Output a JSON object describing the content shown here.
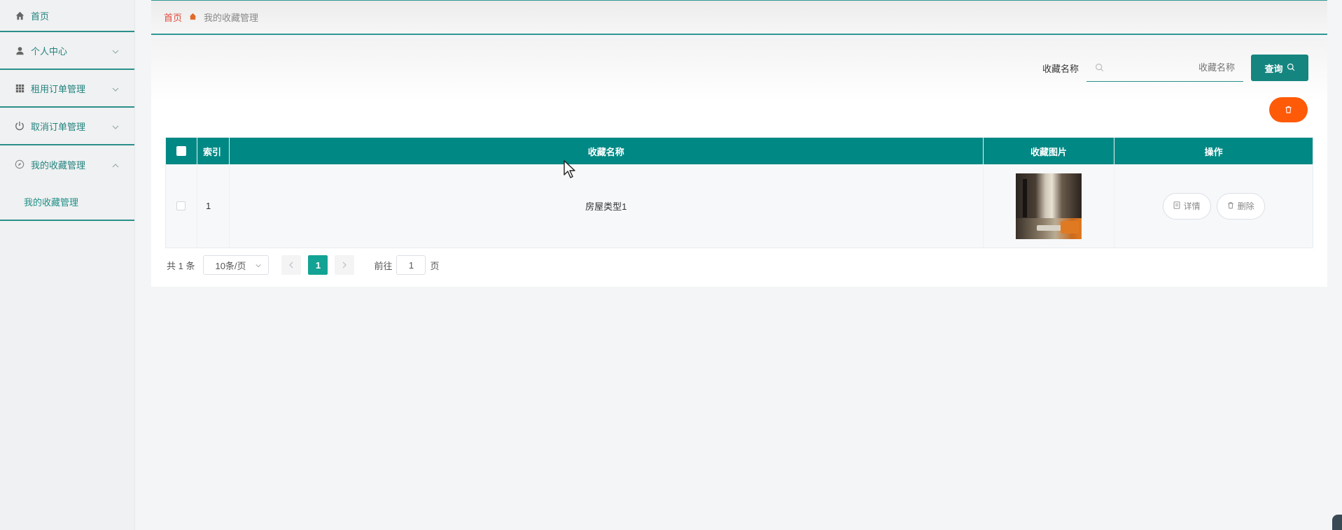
{
  "sidebar": {
    "home": "首页",
    "items": [
      {
        "label": "个人中心"
      },
      {
        "label": "租用订单管理"
      },
      {
        "label": "取消订单管理"
      },
      {
        "label": "我的收藏管理"
      }
    ],
    "submenu": {
      "label": "我的收藏管理"
    }
  },
  "breadcrumb": {
    "home": "首页",
    "current": "我的收藏管理"
  },
  "search": {
    "label": "收藏名称",
    "placeholder": "收藏名称",
    "button": "查询"
  },
  "table": {
    "headers": {
      "index": "索引",
      "name": "收藏名称",
      "image": "收藏图片",
      "ops": "操作"
    },
    "rows": [
      {
        "index": "1",
        "name": "房屋类型1",
        "detail": "详情",
        "delete": "删除"
      }
    ]
  },
  "pagination": {
    "total": "共 1 条",
    "page_size": "10条/页",
    "current_page": "1",
    "goto_label": "前往",
    "goto_value": "1",
    "page_suffix": "页"
  },
  "colors": {
    "primary": "#008884",
    "danger": "#ff5a08",
    "breadcrumb_home": "#e24a3b"
  }
}
